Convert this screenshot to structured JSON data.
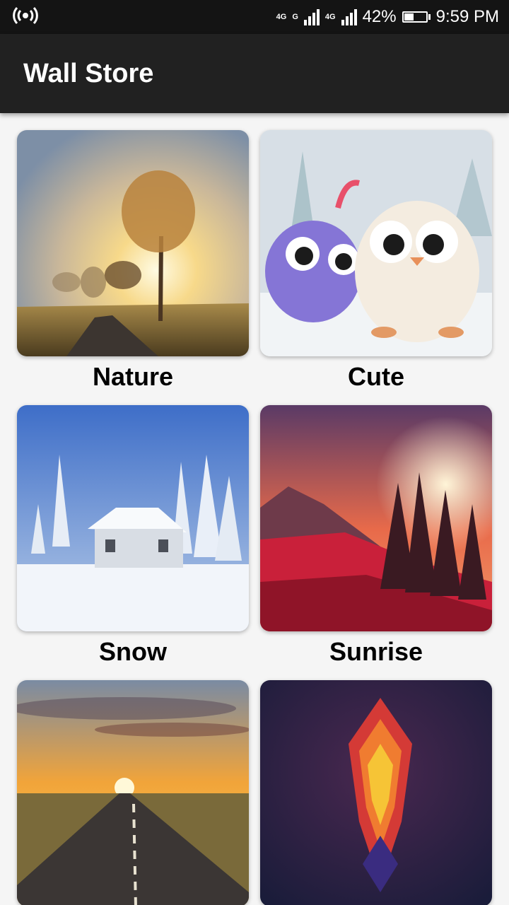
{
  "status_bar": {
    "hotspot_icon": "wifi-hotspot-icon",
    "network_1": "4G",
    "network_1_sub": "G",
    "network_2": "4G",
    "battery_percent": "42%",
    "battery_level": 0.42,
    "time": "9:59 PM"
  },
  "app_bar": {
    "title": "Wall Store"
  },
  "categories": [
    {
      "label": "Nature"
    },
    {
      "label": "Cute"
    },
    {
      "label": "Snow"
    },
    {
      "label": "Sunrise"
    },
    {
      "label": ""
    },
    {
      "label": ""
    }
  ]
}
